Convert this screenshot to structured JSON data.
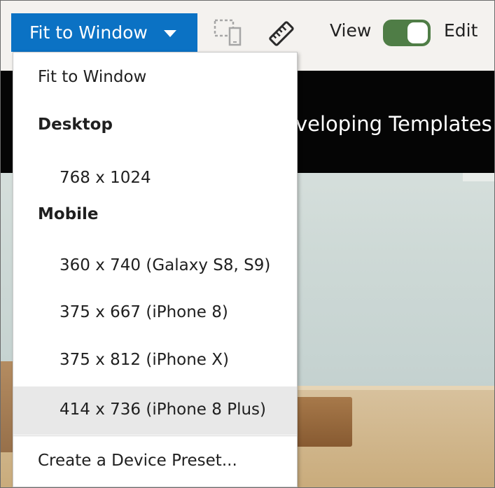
{
  "toolbar": {
    "fit_button_label": "Fit to Window",
    "view_label": "View",
    "edit_label": "Edit",
    "mode_toggle_state": "edit",
    "toggle_color": "#4f7d46",
    "accent_color": "#0b72c4",
    "device_icon": "device-icon",
    "ruler_icon": "ruler-icon"
  },
  "preview": {
    "header_title": "veloping Templates"
  },
  "menu": {
    "fit_to_window": "Fit to Window",
    "desktop_header": "Desktop",
    "desktop_items": [
      "768 x 1024"
    ],
    "mobile_header": "Mobile",
    "mobile_items": [
      "360 x 740 (Galaxy S8, S9)",
      "375 x 667 (iPhone 8)",
      "375 x 812 (iPhone X)",
      "414 x 736 (iPhone 8 Plus)"
    ],
    "highlighted_item": "414 x 736 (iPhone 8 Plus)",
    "create_preset": "Create a Device Preset..."
  }
}
